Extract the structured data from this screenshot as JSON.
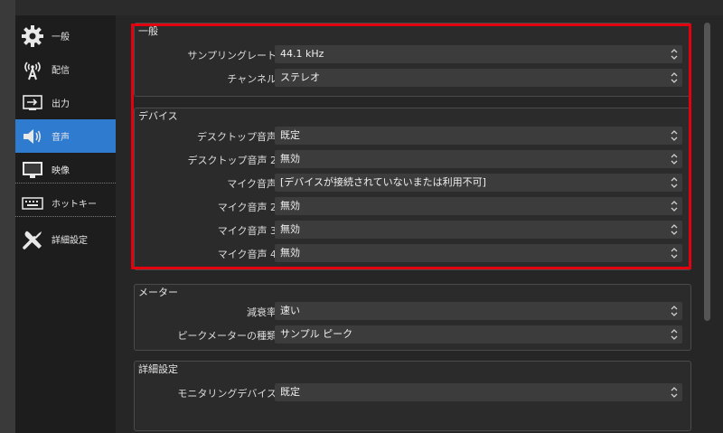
{
  "sidebar": {
    "items": [
      {
        "label": "一般",
        "icon": "gear-icon"
      },
      {
        "label": "配信",
        "icon": "broadcast-icon"
      },
      {
        "label": "出力",
        "icon": "output-icon"
      },
      {
        "label": "音声",
        "icon": "speaker-icon"
      },
      {
        "label": "映像",
        "icon": "monitor-icon"
      },
      {
        "label": "ホットキー",
        "icon": "keyboard-icon"
      },
      {
        "label": "詳細設定",
        "icon": "tools-icon"
      }
    ],
    "active_index": 3
  },
  "general": {
    "title": "一般",
    "sample_rate": {
      "label": "サンプリングレート",
      "value": "44.1 kHz"
    },
    "channels": {
      "label": "チャンネル",
      "value": "ステレオ"
    }
  },
  "devices": {
    "title": "デバイス",
    "rows": [
      {
        "label": "デスクトップ音声",
        "value": "既定"
      },
      {
        "label": "デスクトップ音声 2",
        "value": "無効"
      },
      {
        "label": "マイク音声",
        "value": "[デバイスが接続されていないまたは利用不可]"
      },
      {
        "label": "マイク音声 2",
        "value": "無効"
      },
      {
        "label": "マイク音声 3",
        "value": "無効"
      },
      {
        "label": "マイク音声 4",
        "value": "無効"
      }
    ]
  },
  "meters": {
    "title": "メーター",
    "decay": {
      "label": "減衰率",
      "value": "速い"
    },
    "peak_type": {
      "label": "ピークメーターの種類",
      "value": "サンプル ピーク"
    }
  },
  "advanced": {
    "title": "詳細設定",
    "monitoring": {
      "label": "モニタリングデバイス",
      "value": "既定"
    }
  },
  "colors": {
    "accent": "#2f7bd0",
    "highlight": "#e3000f"
  }
}
